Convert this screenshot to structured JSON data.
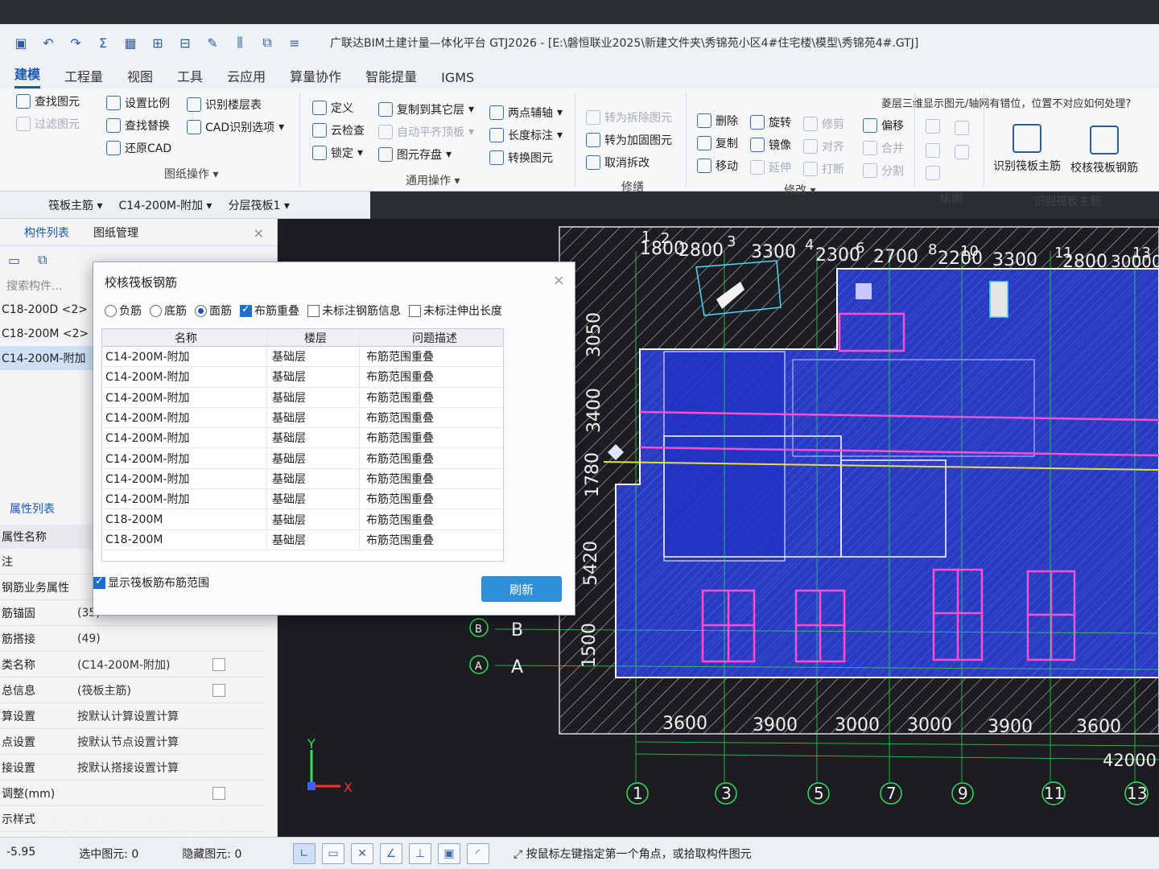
{
  "app": {
    "title": "广联达BIM土建计量—体化平台 GTJ2026 - [E:\\磐恒联业2025\\新建文件夹\\秀锦苑小区4#住宅楼\\模型\\秀锦苑4#.GTJ]"
  },
  "ribbon": {
    "tabs": [
      "建模",
      "工程量",
      "视图",
      "工具",
      "云应用",
      "算量协作",
      "智能提量",
      "IGMS"
    ],
    "active_tab": "建模",
    "tip": "菱层三维显示图元/轴网有错位，位置不对应如何处理?",
    "drawing_ops": {
      "label": "图纸操作",
      "items": [
        "查找图元",
        "过滤图元",
        "设置比例",
        "查找替换",
        "还原CAD",
        "识别楼层表",
        "CAD识别选项"
      ]
    },
    "general_ops": {
      "label": "通用操作",
      "items": [
        "定义",
        "云检查",
        "锁定",
        "复制到其它层",
        "自动平齐顶板",
        "图元存盘",
        "两点辅轴",
        "长度标注",
        "转换图元"
      ]
    },
    "repair": {
      "label": "修缮",
      "items": [
        "转为拆除图元",
        "转为加固图元",
        "取消拆改"
      ]
    },
    "modify": {
      "label": "修改",
      "items": [
        "删除",
        "复制",
        "移动",
        "旋转",
        "镜像",
        "延伸",
        "修剪",
        "对齐",
        "打断",
        "偏移",
        "合并",
        "分割"
      ]
    },
    "draw": {
      "label": "绘图"
    },
    "identify": {
      "label": "识别筏板主筋",
      "items": [
        "识别筏板主筋",
        "校核筏板钢筋"
      ]
    }
  },
  "selector": {
    "category": "筏板主筋",
    "component": "C14-200M-附加",
    "layer": "分层筏板1"
  },
  "left_panel": {
    "tabs": [
      "构件列表",
      "图纸管理"
    ],
    "search_placeholder": "搜索构件...",
    "items": [
      "C18-200D <2>",
      "C18-200M <2>",
      "C14-200M-附加"
    ],
    "props_title": "属性列表",
    "props_header": "属性名称",
    "props": [
      {
        "name": "注",
        "value": ""
      },
      {
        "name": "钢筋业务属性",
        "value": ""
      },
      {
        "name": "筋锚固",
        "value": "(35)"
      },
      {
        "name": "筋搭接",
        "value": "(49)"
      },
      {
        "name": "类名称",
        "value": "(C14-200M-附加)"
      },
      {
        "name": "总信息",
        "value": "(筏板主筋)"
      },
      {
        "name": "算设置",
        "value": "按默认计算设置计算"
      },
      {
        "name": "点设置",
        "value": "按默认节点设置计算"
      },
      {
        "name": "接设置",
        "value": "按默认搭接设置计算"
      },
      {
        "name": "调整(mm)",
        "value": ""
      },
      {
        "name": "示样式",
        "value": ""
      }
    ]
  },
  "dialog": {
    "title": "校核筏板钢筋",
    "close": "×",
    "radios": [
      "负筋",
      "底筋",
      "面筋"
    ],
    "selected_radio": "面筋",
    "checks": [
      {
        "label": "布筋重叠",
        "checked": true
      },
      {
        "label": "未标注钢筋信息",
        "checked": false
      },
      {
        "label": "未标注伸出长度",
        "checked": false
      }
    ],
    "columns": [
      "名称",
      "楼层",
      "问题描述"
    ],
    "rows": [
      [
        "C14-200M-附加",
        "基础层",
        "布筋范围重叠"
      ],
      [
        "C14-200M-附加",
        "基础层",
        "布筋范围重叠"
      ],
      [
        "C14-200M-附加",
        "基础层",
        "布筋范围重叠"
      ],
      [
        "C14-200M-附加",
        "基础层",
        "布筋范围重叠"
      ],
      [
        "C14-200M-附加",
        "基础层",
        "布筋范围重叠"
      ],
      [
        "C14-200M-附加",
        "基础层",
        "布筋范围重叠"
      ],
      [
        "C14-200M-附加",
        "基础层",
        "布筋范围重叠"
      ],
      [
        "C14-200M-附加",
        "基础层",
        "布筋范围重叠"
      ],
      [
        "C18-200M",
        "基础层",
        "布筋范围重叠"
      ],
      [
        "C18-200M",
        "基础层",
        "布筋范围重叠"
      ]
    ],
    "show_range_label": "显示筏板筋布筋范围",
    "show_range_checked": true,
    "refresh_label": "刷新"
  },
  "canvas": {
    "top_dims": [
      "1800",
      "2800",
      "3300",
      "2300",
      "2700",
      "2200",
      "3300",
      "2800",
      "30000"
    ],
    "top_axes": [
      "1",
      "2",
      "3",
      "4",
      "6",
      "8",
      "10",
      "11",
      "13"
    ],
    "left_dims": [
      "3050",
      "3400",
      "1780",
      "5420",
      "1500"
    ],
    "row_axes": [
      "B",
      "A"
    ],
    "bottom_dims": [
      "3600",
      "3900",
      "3000",
      "3000",
      "3900",
      "3600"
    ],
    "bottom_total": "42000",
    "bottom_axes": [
      "1",
      "3",
      "5",
      "7",
      "9",
      "11",
      "13"
    ],
    "ucs": {
      "y": "Y",
      "x": "X"
    }
  },
  "status": {
    "coord": "-5.95",
    "selected": "选中图元: 0",
    "hidden": "隐藏图元: 0",
    "message": "按鼠标左键指定第一个角点，或拾取构件图元"
  },
  "watermark": "HONOR Magic6",
  "colors": {
    "accent": "#1a56b0",
    "rebar_blue": "#2b3fe0",
    "magenta": "#ff4fd0",
    "cad_green": "#2ee05a",
    "cad_yellow": "#e8e040",
    "refresh": "#2f8fd8"
  }
}
